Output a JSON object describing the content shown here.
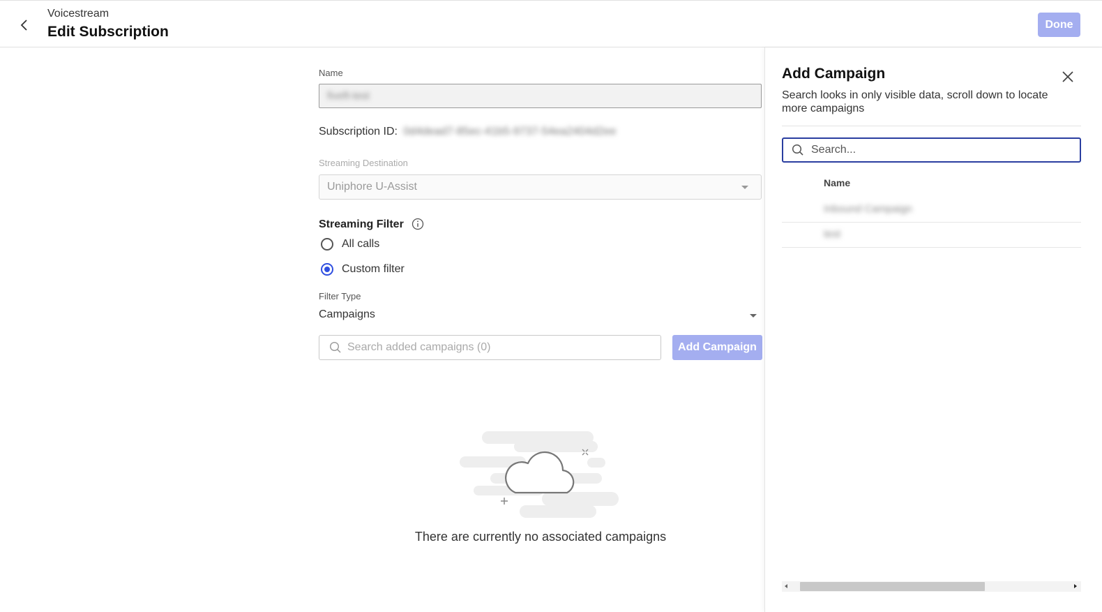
{
  "header": {
    "breadcrumb": "Voicestream",
    "title": "Edit Subscription",
    "done_label": "Done",
    "back_icon": "chevron-left-icon"
  },
  "form": {
    "name_label": "Name",
    "name_value": "fiveft-test",
    "subscription_id_label": "Subscription ID:",
    "subscription_id_value": "0d4dead7-85ec-41b5-9737-54ea2404d2ee",
    "destination_label": "Streaming Destination",
    "destination_value": "Uniphore U-Assist",
    "streaming_filter_title": "Streaming Filter",
    "radio_options": [
      {
        "label": "All calls",
        "selected": false
      },
      {
        "label": "Custom filter",
        "selected": true
      }
    ],
    "filter_type_label": "Filter Type",
    "filter_type_value": "Campaigns",
    "search_placeholder": "Search added campaigns (0)",
    "add_campaign_label": "Add Campaign",
    "empty_message": "There are currently no associated campaigns"
  },
  "panel": {
    "title": "Add Campaign",
    "description": "Search looks in only visible data, scroll down to locate more campaigns",
    "search_placeholder": "Search...",
    "column_name": "Name",
    "rows": [
      {
        "name": "Inbound Campaign"
      },
      {
        "name": "test"
      }
    ],
    "horizontal_scroll_position": 0.03,
    "horizontal_scroll_visible_fraction": 0.66
  },
  "colors": {
    "primary": "#2f4fe0",
    "primary_disabled": "#a4aef0",
    "focus_border": "#2a3ea0"
  }
}
